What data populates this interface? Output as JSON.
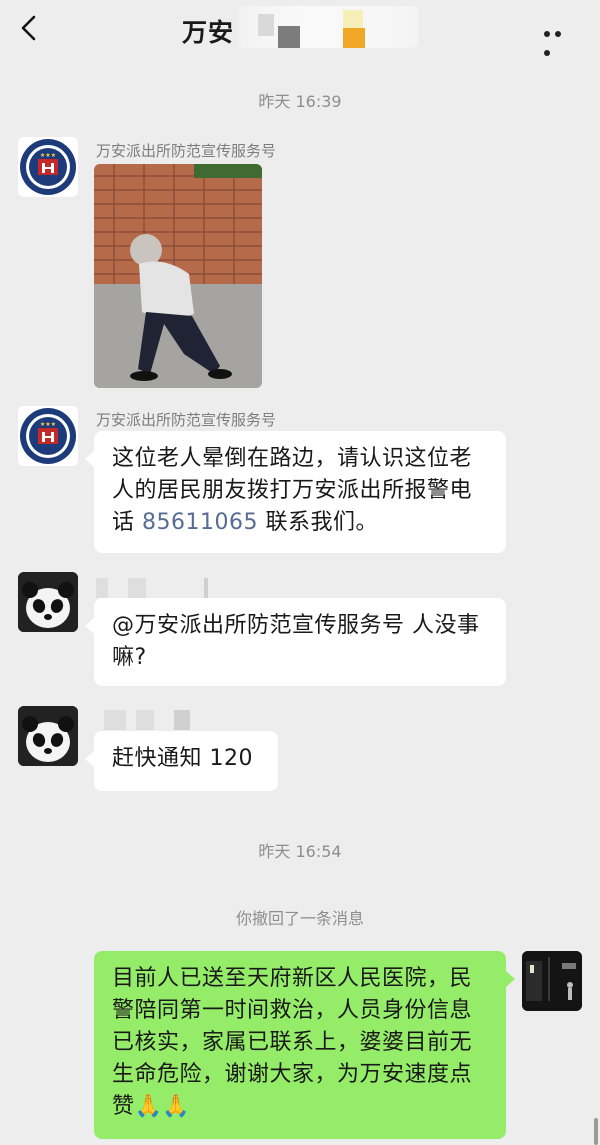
{
  "header": {
    "title": "万安",
    "back_icon": "chevron-left-icon",
    "more_icon": "ellipsis-icon"
  },
  "messages": {
    "time1": "昨天 16:39",
    "police_sender": "万安派出所防范宣传服务号",
    "police_text_1": "这位老人晕倒在路边，请认识这位老人的居民朋友拨打万安派出所报警电话",
    "police_phone": "85611065",
    "police_text_2": "联系我们。",
    "reply1_text": "@万安派出所防范宣传服务号  人没事嘛?",
    "reply2_text": "赶快通知 120",
    "time2": "昨天 16:54",
    "recall_notice": "你撤回了一条消息",
    "my_message": "目前人已送至天府新区人民医院，民警陪同第一时间救治，人员身份信息已核实，家属已联系上，婆婆目前无生命危险，谢谢大家，为万安速度点赞",
    "my_emoji": "🙏🙏"
  },
  "colors": {
    "background": "#ededed",
    "my_bubble": "#95ec69",
    "link": "#576b95"
  }
}
